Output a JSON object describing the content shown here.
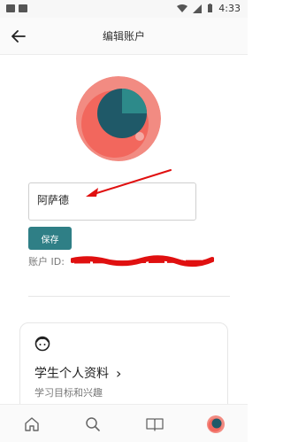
{
  "status_bar": {
    "time": "4:33",
    "left_badges": [
      "notification-badge",
      "app-badge"
    ],
    "icons": [
      "wifi-icon",
      "signal-icon",
      "battery-icon"
    ]
  },
  "header": {
    "title": "编辑账户",
    "back_icon": "back-arrow-icon"
  },
  "profile": {
    "name_value": "阿萨德",
    "save_label": "保存",
    "account_id_label": "账户 ID:"
  },
  "card": {
    "title": "学生个人资料",
    "subtitle": "学习目标和兴趣",
    "chevron": "›"
  },
  "bottom_nav": {
    "items": [
      "home-icon",
      "search-icon",
      "book-icon",
      "profile-avatar-icon"
    ]
  },
  "colors": {
    "accent": "#2f7f86",
    "avatar_bg": "#f28b82",
    "avatar_ring": "#f2675d",
    "avatar_circle": "#1f5968",
    "annotation_red": "#e01010"
  }
}
